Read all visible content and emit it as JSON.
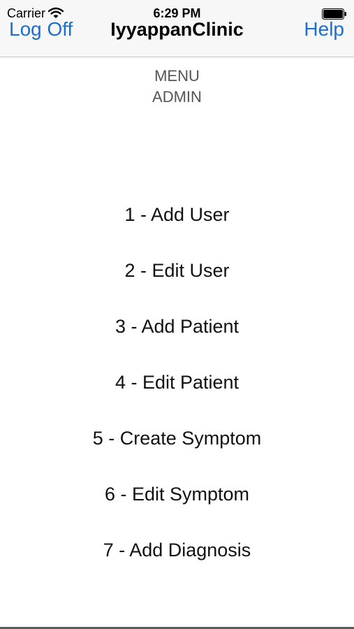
{
  "status_bar": {
    "carrier": "Carrier",
    "time": "6:29 PM",
    "icons": [
      "wifi-icon",
      "battery-icon"
    ]
  },
  "nav": {
    "left_label": "Log Off",
    "title": "IyyappanClinic",
    "right_label": "Help",
    "accent_color": "#1a6fcf"
  },
  "menu": {
    "heading": "MENU",
    "role": "ADMIN",
    "items": [
      {
        "label": "1 - Add User"
      },
      {
        "label": "2 - Edit User"
      },
      {
        "label": "3 - Add Patient"
      },
      {
        "label": "4 - Edit Patient"
      },
      {
        "label": "5 - Create Symptom"
      },
      {
        "label": "6 - Edit Symptom"
      },
      {
        "label": "7 - Add Diagnosis"
      }
    ]
  }
}
